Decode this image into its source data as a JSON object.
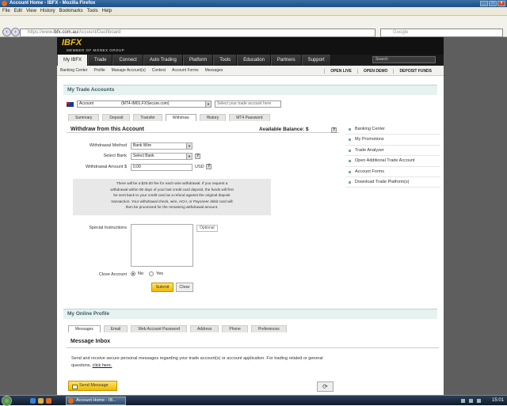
{
  "window": {
    "title": "Account Home - IBFX - Mozilla Firefox"
  },
  "menubar": [
    "File",
    "Edit",
    "View",
    "History",
    "Bookmarks",
    "Tools",
    "Help"
  ],
  "navbar": {
    "url_scheme": "https://www.",
    "url_host": "ibfx.com.au",
    "url_path": "/Account/Dashboard",
    "search_placeholder": "Google"
  },
  "site": {
    "brand": "IBFX",
    "brand_sub": "MEMBER OF MONEX GROUP",
    "topright": "",
    "tabs": [
      "My IBFX",
      "Trade",
      "Connect",
      "Auto Trading",
      "Platform",
      "Tools",
      "Education",
      "Partners",
      "Support"
    ],
    "search_placeholder": "Search",
    "subnav": [
      "Banking Center",
      "Profile",
      "Manage Account(s)",
      "Contest",
      "Account Forms",
      "Messages"
    ],
    "open_links": [
      "OPEN LIVE",
      "OPEN DEMO",
      "DEPOSIT FUNDS"
    ]
  },
  "trade": {
    "heading": "My Trade Accounts",
    "account_label": "Account",
    "account_value": "(MT4-IM01.FXSecure.com)",
    "account_placeholder": "Select your trade account here",
    "subtabs": [
      "Summary",
      "Deposit",
      "Transfer",
      "Withdraw",
      "History",
      "MT4 Password"
    ],
    "active_subtab": "Withdraw",
    "withdraw_title": "Withdraw from this Account",
    "available_balance": "Available Balance: $",
    "method_label": "Withdrawal Method",
    "method_value": "Bank Wire",
    "bank_label": "Select Bank",
    "bank_value": "Select Bank",
    "amount_label": "Withdrawal Amount $",
    "amount_value": "0.00",
    "currency": "USD",
    "notice_lines": [
      "There will be a $25.00 fee for each wire withdrawal. If you request a",
      "withdrawal within 90 days of your last credit card deposit, the funds will first",
      "be sent back to your credit card as a refund against the original deposit",
      "transaction. Your withdrawal check, wire, ACH, or Payoneer debit card will",
      "then be processed for the remaining withdrawal amount."
    ],
    "special_label": "Special Instructions",
    "optional_label": "Optional",
    "close_label": "Close Account",
    "no_label": "No",
    "yes_label": "Yes",
    "submit_label": "Submit",
    "clear_label": "Clear"
  },
  "sidebar": [
    "Banking Center",
    "My Promotions",
    "Trade Analyzer",
    "Open Additional Trade Account",
    "Account Forms",
    "Download Trade Platform(s)"
  ],
  "profile": {
    "heading": "My Online Profile",
    "tabs": [
      "Messages",
      "Email",
      "Web Account Password",
      "Address",
      "Phone",
      "Preferences"
    ],
    "inbox_title": "Message Inbox",
    "inbox_text": "Send and receive secure personal messages regarding your trade account(s) or account application. For trading related or general questions,",
    "inbox_link": "click here.",
    "send_label": "Send Message"
  },
  "taskbar": {
    "item": "Account Home - IB...",
    "clock": "15:01"
  },
  "colors": {
    "accent": "#f2b800",
    "panel_head": "#e6f1f0",
    "nav_dark": "#1a1a1a"
  }
}
